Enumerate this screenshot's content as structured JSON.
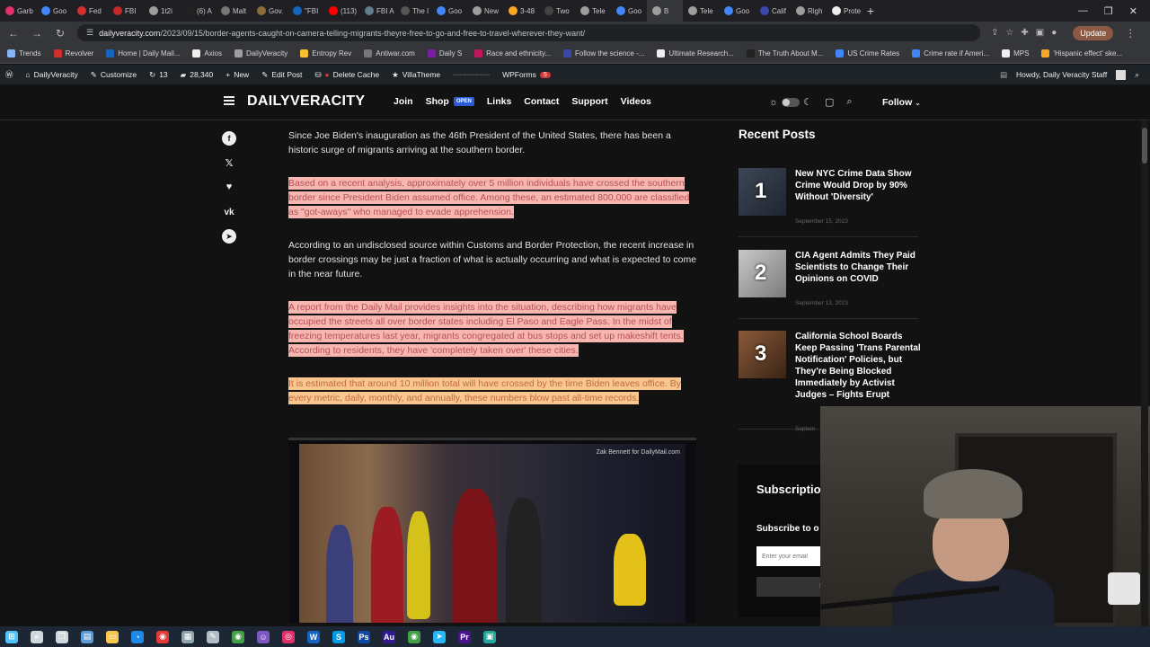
{
  "browser": {
    "tabs": [
      {
        "label": "Garb",
        "icon": "instagram-icon",
        "color": "#e1306c"
      },
      {
        "label": "Goo",
        "icon": "google-icon",
        "color": "#4285f4"
      },
      {
        "label": "Fed",
        "icon": "t-icon",
        "color": "#d32f2f"
      },
      {
        "label": "FBI",
        "icon": "flag-icon",
        "color": "#c62828"
      },
      {
        "label": "1t2i",
        "icon": "globe-icon",
        "color": "#9e9e9e"
      },
      {
        "label": "(6) A",
        "icon": "x-icon",
        "color": "#222222"
      },
      {
        "label": "Malt",
        "icon": "page-icon",
        "color": "#777777"
      },
      {
        "label": "Gov.",
        "icon": "page-icon",
        "color": "#8b6d3a"
      },
      {
        "label": "\"FBI",
        "icon": "page-icon",
        "color": "#1565c0"
      },
      {
        "label": "(113)",
        "icon": "youtube-icon",
        "color": "#ff0000"
      },
      {
        "label": "FBI A",
        "icon": "page-icon",
        "color": "#607d8b"
      },
      {
        "label": "The I",
        "icon": "page-icon",
        "color": "#555555"
      },
      {
        "label": "Goo",
        "icon": "google-icon",
        "color": "#4285f4"
      },
      {
        "label": "New",
        "icon": "globe-icon",
        "color": "#9e9e9e"
      },
      {
        "label": "3-48",
        "icon": "doc-icon",
        "color": "#f9a825"
      },
      {
        "label": "Two",
        "icon": "page-icon",
        "color": "#444444"
      },
      {
        "label": "Tele",
        "icon": "globe-icon",
        "color": "#9e9e9e"
      },
      {
        "label": "Goo",
        "icon": "google-icon",
        "color": "#4285f4"
      },
      {
        "label": "B",
        "icon": "globe-icon",
        "color": "#9e9e9e"
      },
      {
        "label": "Tele",
        "icon": "globe-icon",
        "color": "#9e9e9e"
      },
      {
        "label": "Goo",
        "icon": "google-icon",
        "color": "#4285f4"
      },
      {
        "label": "Calif",
        "icon": "page-icon",
        "color": "#3949ab"
      },
      {
        "label": "Righ",
        "icon": "globe-icon",
        "color": "#9e9e9e"
      },
      {
        "label": "Prote",
        "icon": "page-icon",
        "color": "#eeeeee"
      }
    ],
    "active_tab_index": 18,
    "url_domain": "dailyveracity.com",
    "url_path": "/2023/09/15/border-agents-caught-on-camera-telling-migrants-theyre-free-to-go-and-free-to-travel-wherever-they-want/",
    "update_label": "Update",
    "bookmarks": [
      {
        "label": "Trends",
        "color": "#8ab4f8"
      },
      {
        "label": "Revolver",
        "color": "#d32f2f"
      },
      {
        "label": "Home | Daily Mail...",
        "color": "#1565c0"
      },
      {
        "label": "Axios",
        "color": "#eeeeee"
      },
      {
        "label": "DailyVeracity",
        "color": "#9e9e9e"
      },
      {
        "label": "Entropy Rev",
        "color": "#fbc02d"
      },
      {
        "label": "Antiwar.com",
        "color": "#777777"
      },
      {
        "label": "Daily S",
        "color": "#7b1fa2"
      },
      {
        "label": "Race and ethnicity...",
        "color": "#c2185b"
      },
      {
        "label": "Follow the science -...",
        "color": "#3949ab"
      },
      {
        "label": "Ultimate Research...",
        "color": "#eeeeee"
      },
      {
        "label": "The Truth About M...",
        "color": "#222222"
      },
      {
        "label": "US Crime Rates",
        "color": "#4285f4"
      },
      {
        "label": "Crime rate if Ameri...",
        "color": "#4285f4"
      },
      {
        "label": "MPS",
        "color": "#eeeeee"
      },
      {
        "label": "'Hispanic effect' ske...",
        "color": "#f9a825"
      }
    ]
  },
  "wp_admin_bar": {
    "site": "DailyVeracity",
    "customize": "Customize",
    "updates_count": "13",
    "comments_count": "28,340",
    "new": "New",
    "edit_post": "Edit Post",
    "delete_cache": "Delete Cache",
    "villatheme": "VillaTheme",
    "wpforms": "WPForms",
    "wpforms_badge": "5",
    "howdy": "Howdy, Daily Veracity Staff"
  },
  "site": {
    "logo": "DAILYVERACITY",
    "nav": [
      "Join",
      "Shop",
      "Links",
      "Contact",
      "Support",
      "Videos"
    ],
    "open_badge": "OPEN",
    "follow": "Follow"
  },
  "article": {
    "paragraphs": [
      {
        "text": "Since Joe Biden's inauguration as the 46th President of the United States, there has been a historic surge of migrants arriving at the southern border.",
        "highlight": "none"
      },
      {
        "text": "Based on a recent analysis, approximately over 5 million individuals have crossed the southern border since President Biden assumed office. Among these, an estimated 800,000 are classified as \"got-aways\" who managed to evade apprehension.",
        "highlight": "pink"
      },
      {
        "text": "According to an undisclosed source within Customs and Border Protection, the recent increase in border crossings may be just a fraction of what is actually occurring and what is expected to come in the near future.",
        "highlight": "none"
      },
      {
        "text": "A report from the Daily Mail provides insights into the situation, describing how migrants have occupied the streets all over border states including El Paso and Eagle Pass. In the midst of freezing temperatures last year, migrants congregated at bus stops and set up makeshift tents. According to residents, they have 'completely taken over' these cities.",
        "highlight": "pink"
      },
      {
        "text": "It is estimated that around 10 million total will have crossed by the time Biden leaves office. By every metric, daily, monthly, and annually, these numbers blow past all-time records.",
        "highlight": "orange"
      }
    ],
    "video_caption": "Zak Bennett for DailyMail.com"
  },
  "sidebar": {
    "title": "Recent Posts",
    "posts": [
      {
        "num": "1",
        "title": "New NYC Crime Data Show Crime Would Drop by 90% Without 'Diversity'",
        "date": "September 15, 2023"
      },
      {
        "num": "2",
        "title": "CIA Agent Admits They Paid Scientists to Change Their Opinions on COVID",
        "date": "September 13, 2023"
      },
      {
        "num": "3",
        "title": "California School Boards Keep Passing 'Trans Parental Notification' Policies, but They're Being Blocked Immediately by Activist Judges – Fights Erupt",
        "date": "Septem"
      }
    ],
    "subscribe_title": "Subscriptio",
    "subscribe_label": "Subscribe to o",
    "subscribe_placeholder": "Enter your email",
    "subscribe_button": "SUBS"
  },
  "taskbar": {
    "apps": [
      {
        "icon": "windows-start-icon",
        "color": "#4fc3f7"
      },
      {
        "icon": "search-icon",
        "color": "#cfd8dc"
      },
      {
        "icon": "task-view-icon",
        "color": "#cfd8dc"
      },
      {
        "icon": "file-explorer-icon",
        "color": "#5c9bd6"
      },
      {
        "icon": "folder-icon",
        "color": "#f9c74f"
      },
      {
        "icon": "edge-icon",
        "color": "#1e88e5"
      },
      {
        "icon": "chrome-icon",
        "color": "#e53935"
      },
      {
        "icon": "store-icon",
        "color": "#90a4ae"
      },
      {
        "icon": "pen-icon",
        "color": "#b0bec5"
      },
      {
        "icon": "chrome-icon",
        "color": "#43a047"
      },
      {
        "icon": "discord-icon",
        "color": "#7e57c2"
      },
      {
        "icon": "instagram-icon",
        "color": "#e1306c"
      },
      {
        "icon": "word-icon",
        "color": "#1565c0"
      },
      {
        "icon": "skype-icon",
        "color": "#039be5"
      },
      {
        "icon": "photoshop-icon",
        "color": "#0d47a1"
      },
      {
        "icon": "audition-icon",
        "color": "#311b92"
      },
      {
        "icon": "chrome-icon",
        "color": "#43a047"
      },
      {
        "icon": "telegram-icon",
        "color": "#29b6f6"
      },
      {
        "icon": "premiere-icon",
        "color": "#4a148c"
      },
      {
        "icon": "app-icon",
        "color": "#26a69a"
      }
    ],
    "labels": {
      "photoshop": "Ps",
      "audition": "Au",
      "premiere": "Pr",
      "word": "W",
      "skype": "S"
    }
  }
}
